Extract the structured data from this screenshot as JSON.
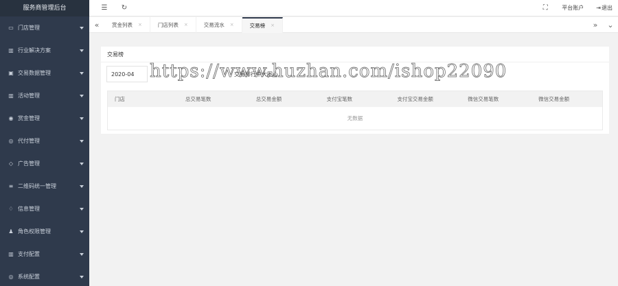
{
  "brand": {
    "title": "服务商管理后台"
  },
  "sidebar": {
    "items": [
      {
        "label": "门店管理",
        "icon": "▭"
      },
      {
        "label": "行业解决方案",
        "icon": "▥"
      },
      {
        "label": "交易数据管理",
        "icon": "▣"
      },
      {
        "label": "活动管理",
        "icon": "▥"
      },
      {
        "label": "赏金管理",
        "icon": "◉"
      },
      {
        "label": "代付管理",
        "icon": "◎"
      },
      {
        "label": "广告管理",
        "icon": "◇"
      },
      {
        "label": "二维码统一管理",
        "icon": "≡"
      },
      {
        "label": "信息管理",
        "icon": "♢"
      },
      {
        "label": "角色权限管理",
        "icon": "♟"
      },
      {
        "label": "支付配置",
        "icon": "▥"
      },
      {
        "label": "系统配置",
        "icon": "◎"
      }
    ]
  },
  "topbar": {
    "menu_icon": "☰",
    "refresh_icon": "↻",
    "fullscreen_icon": "⛶",
    "account_label": "平台账户",
    "logout_icon": "⇥",
    "logout_label": "退出"
  },
  "tabs": {
    "prev_icon": "«",
    "next_icon": "»",
    "more_icon": "⌄",
    "close_icon": "×",
    "items": [
      {
        "label": "赏金列表"
      },
      {
        "label": "门店列表"
      },
      {
        "label": "交易流水"
      },
      {
        "label": "交易榜"
      }
    ]
  },
  "card": {
    "title": "交易榜",
    "date_value": "2020-04",
    "filter_note": "交易排行中大图心"
  },
  "table": {
    "columns": [
      "门店",
      "总交易笔数",
      "总交易金额",
      "支付宝笔数",
      "支付宝交易金额",
      "微信交易笔数",
      "微信交易金额"
    ],
    "empty_text": "无数据"
  },
  "watermark": {
    "text": "https://www.huzhan.com/ishop22090"
  }
}
